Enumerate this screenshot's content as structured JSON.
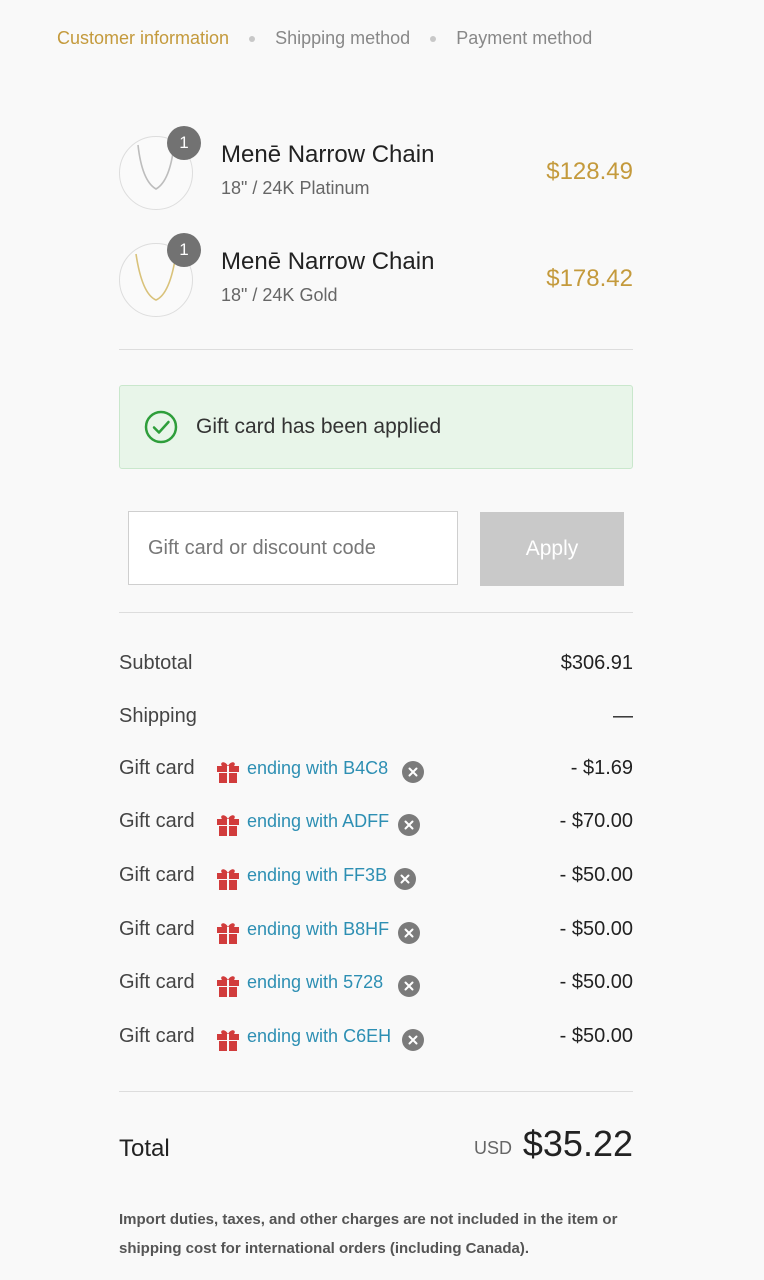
{
  "breadcrumb": {
    "steps": [
      "Customer information",
      "Shipping method",
      "Payment method"
    ]
  },
  "items": [
    {
      "quantity": "1",
      "name": "Menē Narrow Chain",
      "variant": "18\" / 24K Platinum",
      "price": "$128.49"
    },
    {
      "quantity": "1",
      "name": "Menē Narrow Chain",
      "variant": "18\" / 24K Gold",
      "price": "$178.42"
    }
  ],
  "alert": {
    "text": "Gift card has been applied"
  },
  "discount": {
    "placeholder": "Gift card or discount code",
    "apply_label": "Apply"
  },
  "summary": {
    "subtotal_label": "Subtotal",
    "subtotal_value": "$306.91",
    "shipping_label": "Shipping",
    "shipping_value": "—",
    "gift_cards": [
      {
        "label": "Gift card",
        "code": "ending with B4C8",
        "value": "- $1.69"
      },
      {
        "label": "Gift card",
        "code": "ending with ADFF",
        "value": "- $70.00"
      },
      {
        "label": "Gift card",
        "code": "ending with FF3B",
        "value": "- $50.00"
      },
      {
        "label": "Gift card",
        "code": "ending with B8HF",
        "value": "- $50.00"
      },
      {
        "label": "Gift card",
        "code": "ending with 5728",
        "value": "- $50.00"
      },
      {
        "label": "Gift card",
        "code": "ending with C6EH",
        "value": "- $50.00"
      }
    ],
    "total_label": "Total",
    "currency": "USD",
    "total_value": "$35.22"
  },
  "footnote": "Import duties, taxes, and other charges are not included in the item or shipping cost for international orders (including Canada).",
  "colors": {
    "accent": "#c49a3c",
    "link": "#2d8fb3",
    "gift": "#d13c3c",
    "success": "#2e9e3b"
  }
}
